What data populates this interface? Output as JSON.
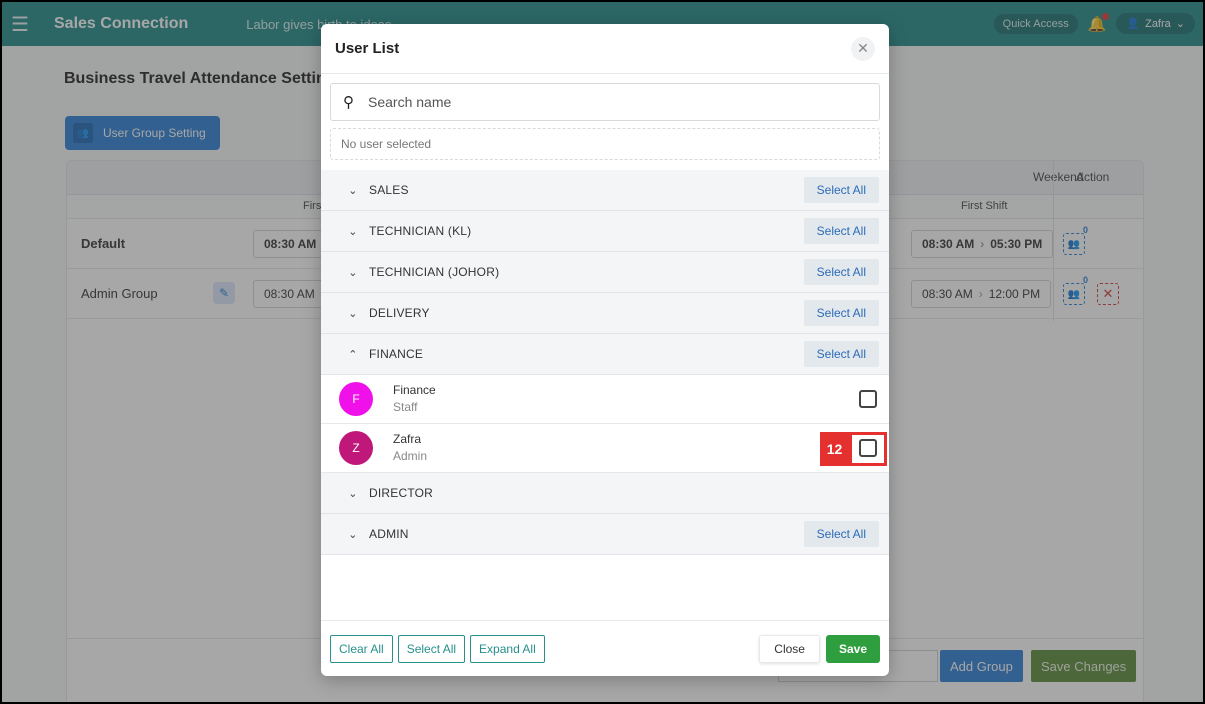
{
  "topbar": {
    "brand": "Sales Connection",
    "tagline": "Labor gives birth to ideas",
    "quick_access": "Quick Access",
    "user": "Zafra"
  },
  "page": {
    "title": "Business Travel Attendance Setting",
    "user_group_setting_label": "User Group Setting",
    "table": {
      "header_week": "Weekend",
      "header_action": "Action",
      "sub_first": "First Shift",
      "sub_first_right": "First Shift",
      "rows": [
        {
          "label": "Default",
          "time_left": "08:30 AM",
          "time_right_start": "08:30 AM",
          "time_right_end": "05:30 PM",
          "count": "0"
        },
        {
          "label": "Admin Group",
          "time_left": "08:30 AM",
          "time_right_start": "08:30 AM",
          "time_right_end": "12:00 PM",
          "count": "0"
        }
      ]
    },
    "add_group": "Add Group",
    "save_changes": "Save Changes"
  },
  "modal": {
    "title": "User List",
    "search_placeholder": "Search name",
    "no_selection": "No user selected",
    "select_all_label": "Select All",
    "groups": [
      {
        "name": "SALES",
        "expanded": false,
        "has_select_all": true
      },
      {
        "name": "TECHNICIAN (KL)",
        "expanded": false,
        "has_select_all": true
      },
      {
        "name": "TECHNICIAN (JOHOR)",
        "expanded": false,
        "has_select_all": true
      },
      {
        "name": "DELIVERY",
        "expanded": false,
        "has_select_all": true
      },
      {
        "name": "FINANCE",
        "expanded": true,
        "has_select_all": true
      },
      {
        "name": "DIRECTOR",
        "expanded": false,
        "has_select_all": false
      },
      {
        "name": "ADMIN",
        "expanded": false,
        "has_select_all": true
      }
    ],
    "finance_users": [
      {
        "initial": "F",
        "name": "Finance",
        "role": "Staff",
        "color": "#f011ea"
      },
      {
        "initial": "Z",
        "name": "Zafra",
        "role": "Admin",
        "color": "#c0177a"
      }
    ],
    "highlight_tag": "12",
    "footer": {
      "clear_all": "Clear All",
      "select_all": "Select All",
      "expand_all": "Expand All",
      "close": "Close",
      "save": "Save"
    }
  },
  "colors": {
    "topbar": "#1f8a89",
    "primary": "#2b7fd6",
    "save_green": "#2e9e3f",
    "highlight_red": "#e53030"
  }
}
